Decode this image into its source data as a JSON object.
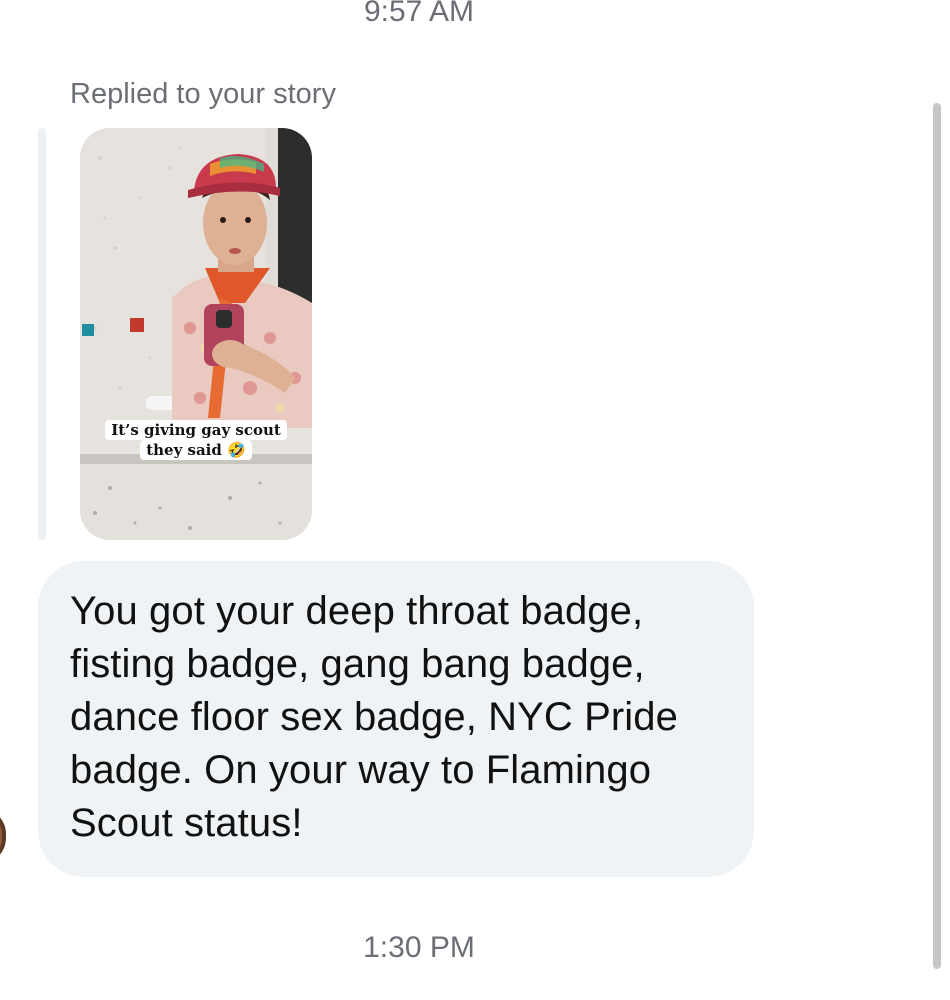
{
  "thread": {
    "timestamp_top": "9:57 AM",
    "reply_label": "Replied to your story",
    "story": {
      "caption_line1": "It’s giving gay scout",
      "caption_line2": "they said 🤣"
    },
    "message_text": "You got your deep throat badge, fisting badge, gang bang badge, dance floor sex badge, NYC Pride badge. On your way to Flamingo Scout status!",
    "timestamp_bottom": "1:30 PM"
  },
  "colors": {
    "bubble_bg": "#f0f3f5",
    "meta_text": "#6b6f75",
    "message_text": "#111111"
  }
}
